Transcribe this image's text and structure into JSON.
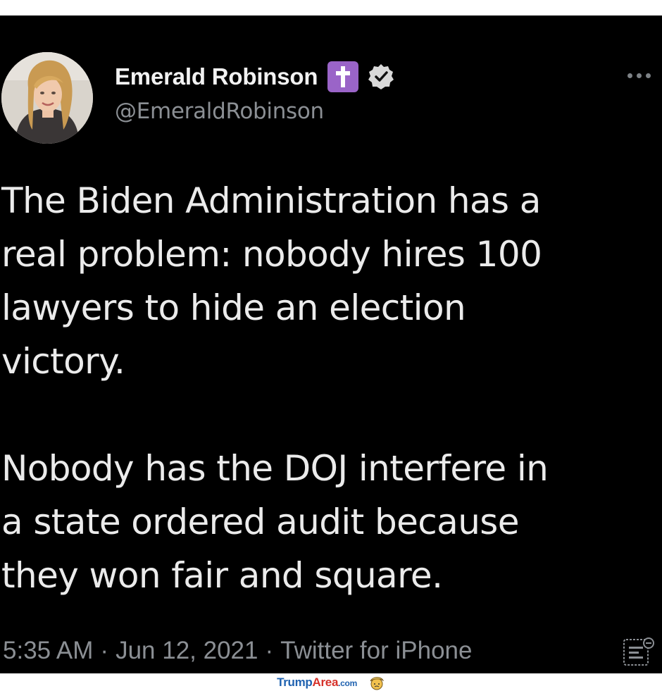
{
  "author": {
    "display_name": "Emerald Robinson",
    "handle": "@EmeraldRobinson",
    "emoji": "✝️",
    "verified": true
  },
  "tweet": {
    "text": "The Biden Administration has a\nreal problem: nobody hires 100\nlawyers to hide an election\nvictory.\n\nNobody has the DOJ interfere in\na state ordered audit because\nthey won fair and square.",
    "time": "5:35 AM",
    "separator": "·",
    "date": "Jun 12, 2021",
    "source": "Twitter for iPhone"
  },
  "icons": {
    "more": "more-options-icon",
    "analytics": "analytics-icon",
    "verified": "verified-badge-icon"
  },
  "watermark": {
    "part1": "Trump",
    "part2": "Area",
    "part3": ".com"
  },
  "colors": {
    "background": "#000000",
    "text": "#e7e9ea",
    "secondary": "#8b8f94",
    "cross_emoji_bg": "#9a64c8",
    "logo_blue": "#1f62b0",
    "logo_red": "#d6322b"
  }
}
